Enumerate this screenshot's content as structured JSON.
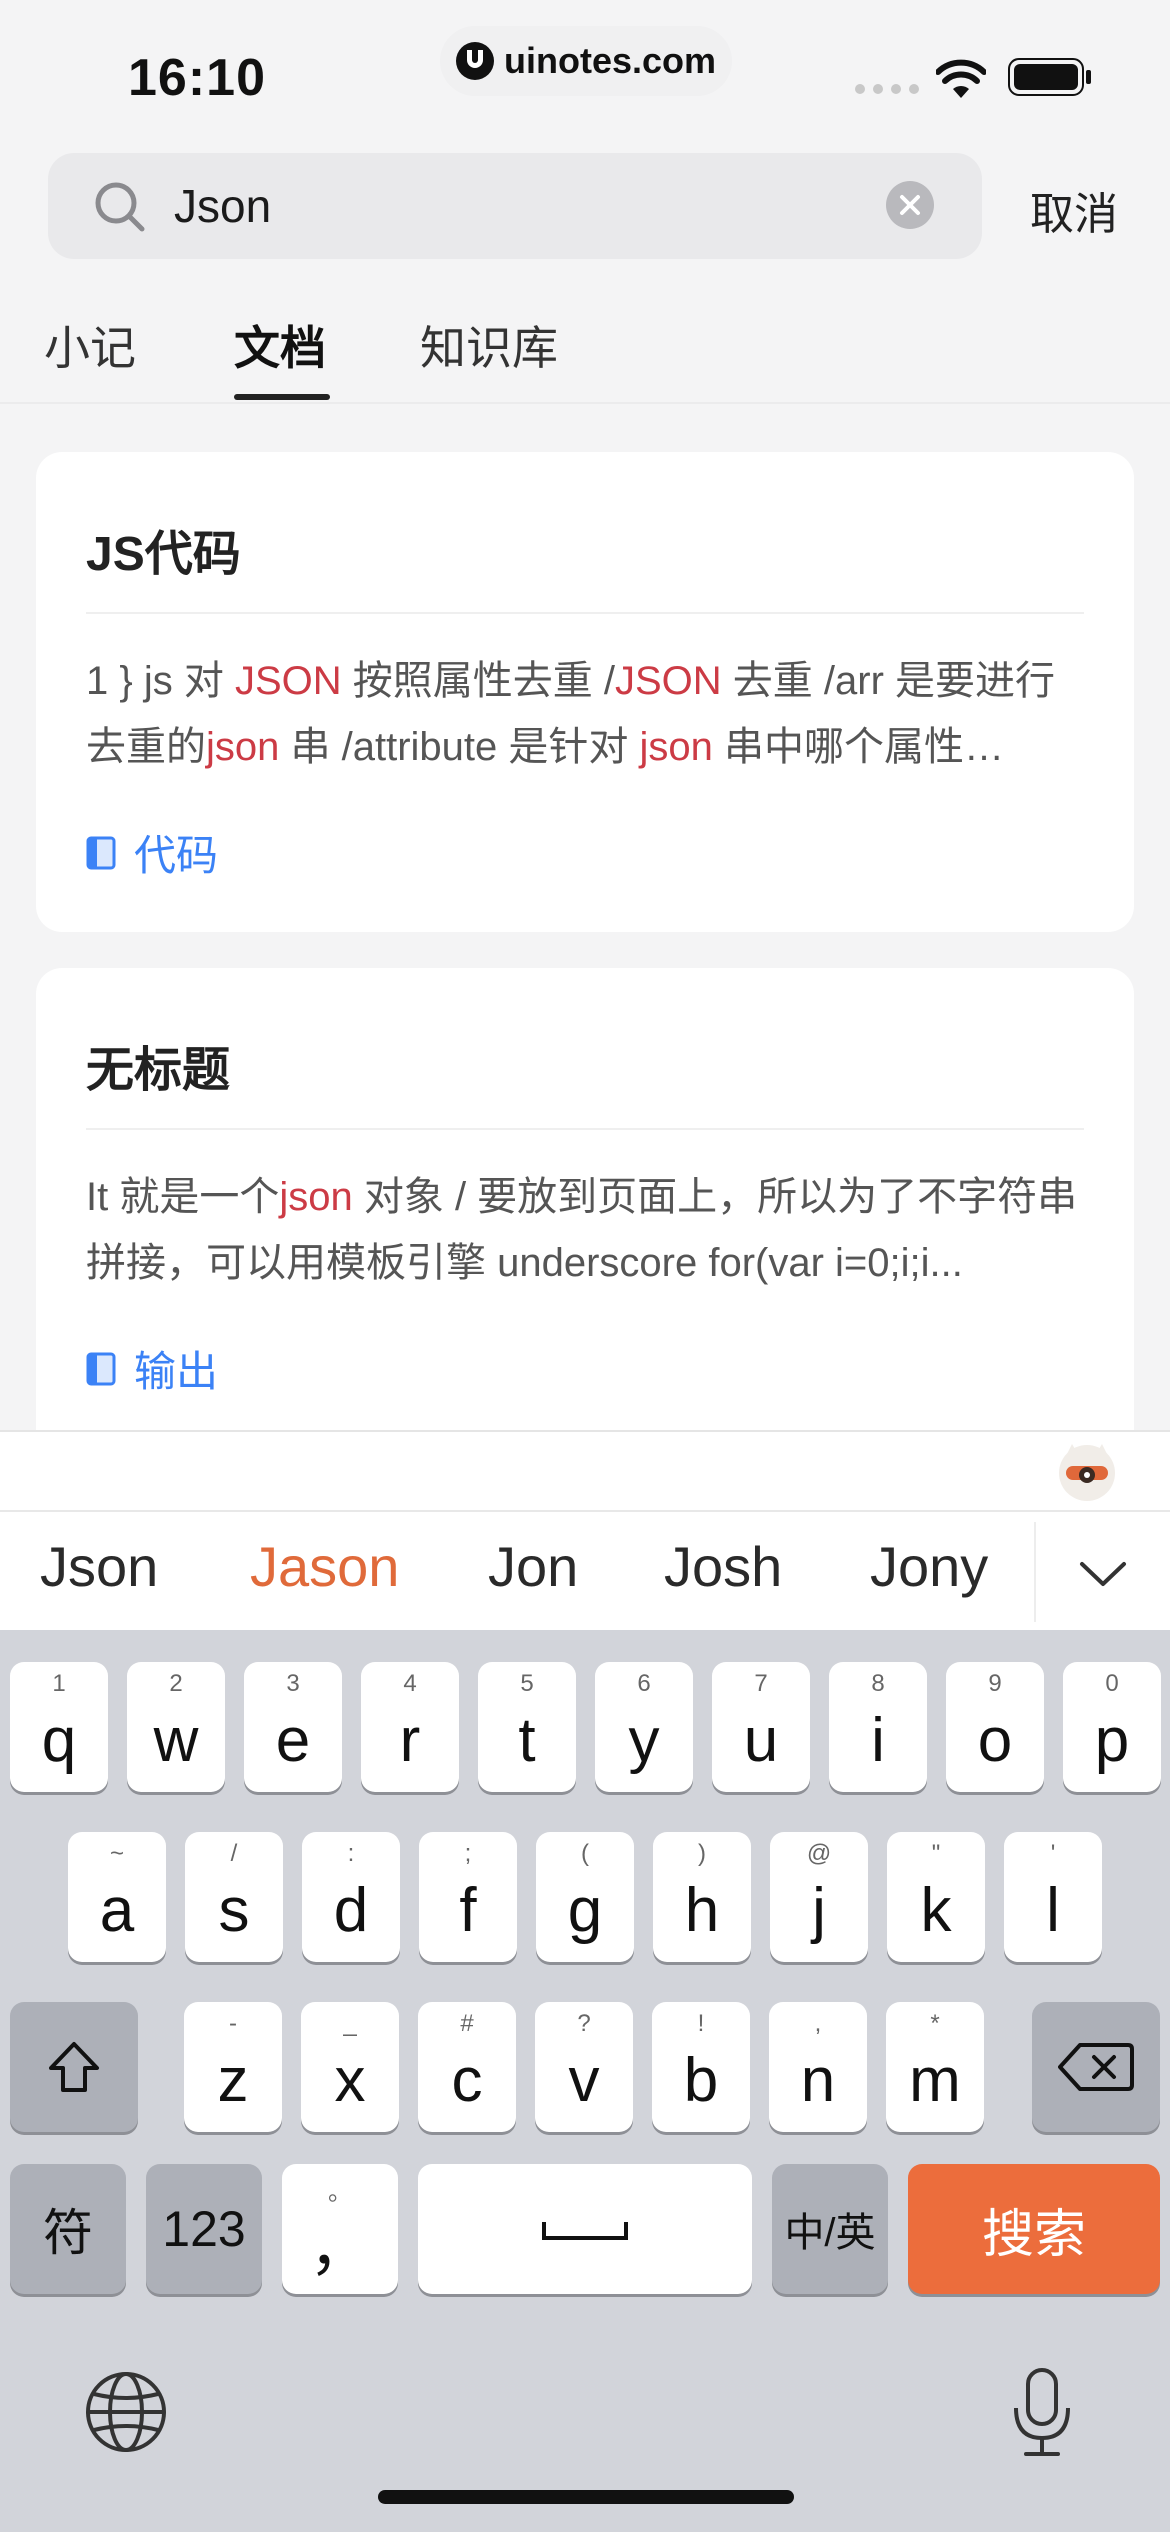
{
  "status": {
    "time": "16:10",
    "url": "uinotes.com"
  },
  "search": {
    "value": "Json",
    "placeholder": "",
    "cancel_label": "取消"
  },
  "tabs": [
    {
      "label": "小记",
      "active": false
    },
    {
      "label": "文档",
      "active": true
    },
    {
      "label": "知识库",
      "active": false
    }
  ],
  "results": [
    {
      "title": "JS代码",
      "snippet": [
        {
          "t": "1 } js 对 ",
          "h": false
        },
        {
          "t": "JSON",
          "h": true
        },
        {
          "t": " 按照属性去重 /",
          "h": false
        },
        {
          "t": "JSON",
          "h": true
        },
        {
          "t": " 去重 /arr 是要进行去重的",
          "h": false
        },
        {
          "t": "json",
          "h": true
        },
        {
          "t": " 串 /attribute 是针对 ",
          "h": false
        },
        {
          "t": "json",
          "h": true
        },
        {
          "t": " 串中哪个属性…",
          "h": false
        }
      ],
      "tag": "代码"
    },
    {
      "title": "无标题",
      "snippet": [
        {
          "t": "It 就是一个",
          "h": false
        },
        {
          "t": "json",
          "h": true
        },
        {
          "t": " 对象 / 要放到页面上，所以为了不字符串拼接，可以用模板引擎 underscore for(var i=0;i;i...",
          "h": false
        }
      ],
      "tag": "输出"
    }
  ],
  "suggestions": [
    "Json",
    "Jason",
    "Jon",
    "Josh",
    "Jony"
  ],
  "keyboard": {
    "row1": [
      {
        "k": "q",
        "h": "1"
      },
      {
        "k": "w",
        "h": "2"
      },
      {
        "k": "e",
        "h": "3"
      },
      {
        "k": "r",
        "h": "4"
      },
      {
        "k": "t",
        "h": "5"
      },
      {
        "k": "y",
        "h": "6"
      },
      {
        "k": "u",
        "h": "7"
      },
      {
        "k": "i",
        "h": "8"
      },
      {
        "k": "o",
        "h": "9"
      },
      {
        "k": "p",
        "h": "0"
      }
    ],
    "row2": [
      {
        "k": "a",
        "h": "~"
      },
      {
        "k": "s",
        "h": "/"
      },
      {
        "k": "d",
        "h": ":"
      },
      {
        "k": "f",
        "h": ";"
      },
      {
        "k": "g",
        "h": "("
      },
      {
        "k": "h",
        "h": ")"
      },
      {
        "k": "j",
        "h": "@"
      },
      {
        "k": "k",
        "h": "\""
      },
      {
        "k": "l",
        "h": "'"
      }
    ],
    "row3": [
      {
        "k": "z",
        "h": "-"
      },
      {
        "k": "x",
        "h": "_"
      },
      {
        "k": "c",
        "h": "#"
      },
      {
        "k": "v",
        "h": "?"
      },
      {
        "k": "b",
        "h": "!"
      },
      {
        "k": "n",
        "h": ","
      },
      {
        "k": "m",
        "h": "*"
      }
    ],
    "symbols_label": "符",
    "numbers_label": "123",
    "punct_label": "，",
    "punct_hint": "。",
    "lang_label": "中/英",
    "search_label": "搜索"
  },
  "colors": {
    "accent_orange": "#ec6d3c",
    "highlight_red": "#cc3b45",
    "link_blue": "#3b82f6"
  }
}
